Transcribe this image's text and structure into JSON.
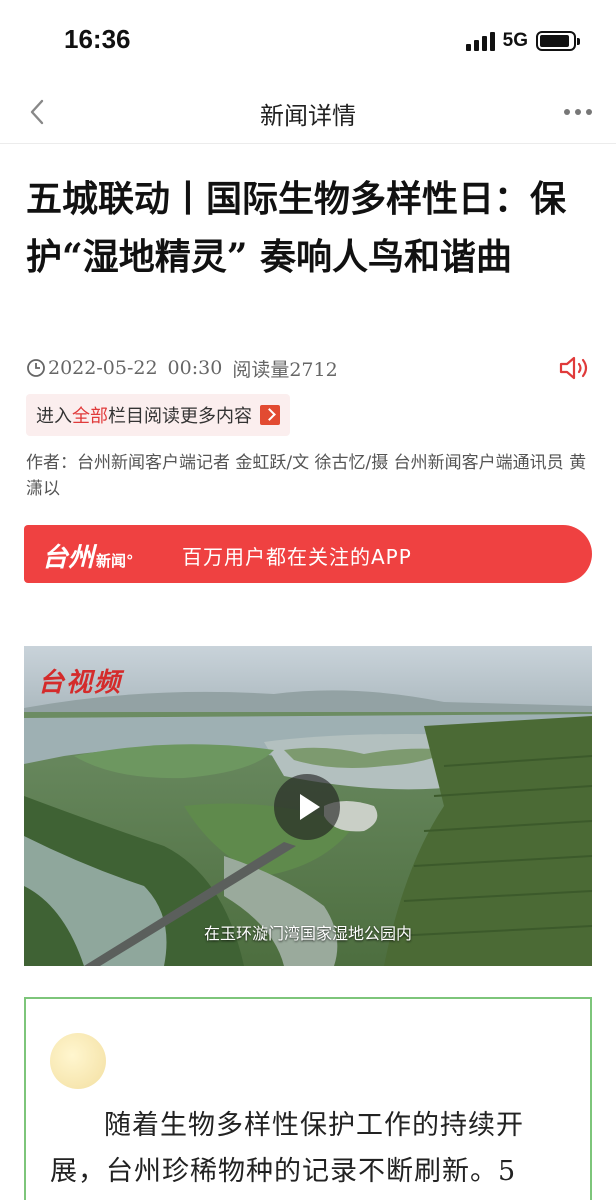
{
  "status_bar": {
    "time": "16:36",
    "network": "5G",
    "battery_level": 0.9
  },
  "nav": {
    "title": "新闻详情",
    "back_icon": "chevron-left-icon",
    "more_icon": "more-horizontal-icon"
  },
  "article": {
    "title": "五城联动丨国际生物多样性日：保护“湿地精灵” 奏响人鸟和谐曲",
    "date": "2022-05-22",
    "time": "00:30",
    "read_count": "阅读量2712",
    "channel_prefix": "进入",
    "channel_name": "全部",
    "channel_suffix": "栏目阅读更多内容",
    "byline": "作者：台州新闻客户端记者 金虹跃/文 徐古忆/摄 台州新闻客户端通讯员 黄潇以"
  },
  "app_banner": {
    "logo_main": "台州",
    "logo_sub": "新闻°",
    "slogan": "百万用户都在关注的APP"
  },
  "video": {
    "logo": "台视频",
    "caption": "在玉环漩门湾国家湿地公园内"
  },
  "quote": {
    "text": "随着生物多样性保护工作的持续开展，台州珍稀物种的记录不断刷新。5"
  },
  "colors": {
    "accent_red": "#ef4141",
    "channel_red": "#e03a3a",
    "quote_border": "#7dc57a"
  }
}
